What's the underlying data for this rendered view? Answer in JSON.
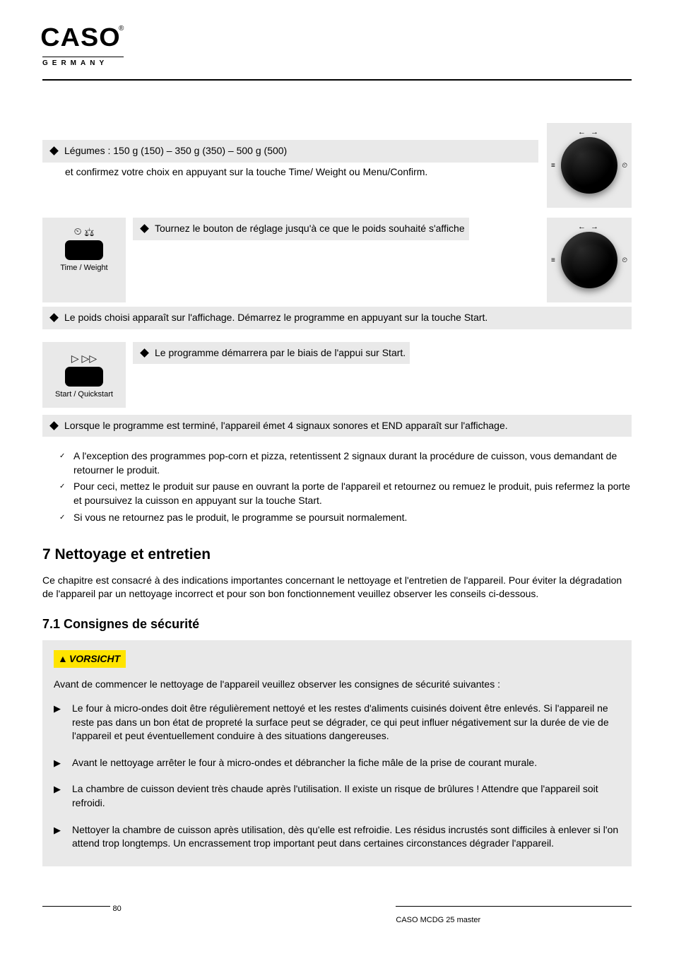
{
  "logo": {
    "main": "CASO",
    "sup": "®",
    "sub": "GERMANY"
  },
  "dial": {
    "arrows": "←  →",
    "leftIcon": "≡",
    "rightIcon": "⏲"
  },
  "steps": {
    "s1": "Légumes : 150 g (150) – 350 g (350) – 500 g (500)",
    "s1b": "et confirmez votre choix en appuyant sur la touche Time/ Weight ou Menu/Confirm.",
    "timeWeight": {
      "icons": "⏲  ⚖",
      "label": "Time / Weight"
    },
    "s2": "Le poids choisi apparaît sur l'affichage. Démarrez le programme en appuyant sur la touche Start.",
    "start": {
      "icons": "▷ ▷▷",
      "label": "Start / Quickstart"
    },
    "s3": "Lorsque le programme est terminé, l'appareil émet 4 signaux sonores et END apparaît sur l'affichage.",
    "s4": "A l'exception des programmes pop-corn et pizza, retentissent 2 signaux durant la procédure de cuisson, vous demandant de retourner le produit.",
    "s5": "Pour ceci, mettez le produit sur pause en ouvrant la porte de l'appareil et retournez ou remuez le produit, puis refermez la porte et poursuivez la cuisson en appuyant sur la touche Start.",
    "s6": "Si vous ne retournez pas le produit, le programme se poursuit normalement."
  },
  "cleaning": {
    "h2": "7    Nettoyage et entretien",
    "p1": "Ce chapitre est consacré à des indications importantes concernant le nettoyage et l'entretien de l'appareil. Pour éviter la dégradation de l'appareil par un nettoyage incorrect et pour son bon fonctionnement veuillez observer les conseils ci-dessous.",
    "h3": "7.1   Consignes de sécurité",
    "caution": {
      "label": "VORSICHT",
      "lead": "Avant de commencer le nettoyage de l'appareil veuillez observer les consignes de sécurité suivantes :",
      "items": [
        "Le four à micro-ondes doit être régulièrement nettoyé et les restes d'aliments cuisinés doivent être enlevés. Si l'appareil ne reste pas dans un bon état de propreté la surface peut se dégrader, ce qui peut influer négativement sur la durée de vie de l'appareil et peut éventuellement conduire à des situations dangereuses.",
        "Avant le nettoyage arrêter le four à micro-ondes et débrancher la fiche mâle de la prise de courant murale.",
        "La chambre de cuisson devient très chaude après l'utilisation. Il existe un risque de brûlures ! Attendre que l'appareil soit refroidi.",
        "Nettoyer la chambre de cuisson après utilisation, dès qu'elle est refroidie. Les résidus incrustés sont difficiles à enlever si l'on attend trop longtemps. Un encrassement trop important peut dans certaines circonstances dégrader l'appareil."
      ]
    }
  },
  "footer": {
    "page": "80",
    "right": "CASO MCDG 25 master"
  }
}
